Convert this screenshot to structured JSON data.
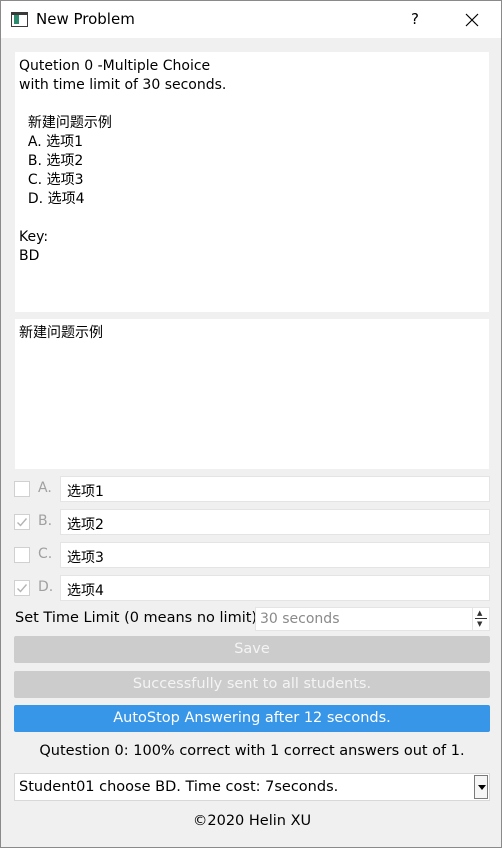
{
  "window": {
    "title": "New Problem",
    "help_label": "?"
  },
  "preview": {
    "text": "Qutetion 0 -Multiple Choice\nwith time limit of 30 seconds.\n\n  新建问题示例\n  A. 选项1\n  B. 选项2\n  C. 选项3\n  D. 选项4\n\nKey:\nBD"
  },
  "question_editor": {
    "value": "新建问题示例"
  },
  "options": [
    {
      "letter": "A.",
      "value": "选项1",
      "checked": false
    },
    {
      "letter": "B.",
      "value": "选项2",
      "checked": true
    },
    {
      "letter": "C.",
      "value": "选项3",
      "checked": false
    },
    {
      "letter": "D.",
      "value": "选项4",
      "checked": true
    }
  ],
  "time_limit": {
    "label": "Set Time Limit (0 means no limit)",
    "value": "30 seconds"
  },
  "buttons": {
    "save": "Save",
    "sent": "Successfully sent to all students.",
    "autostop": "AutoStop Answering after 12 seconds."
  },
  "status": "Qutestion 0: 100% correct with 1 correct answers out of 1.",
  "answers_combo": {
    "selected": "Student01 choose BD. Time cost: 7seconds."
  },
  "footer": "©2020 Helin XU",
  "colors": {
    "accent": "#3796e8",
    "disabled": "#cccccc"
  }
}
